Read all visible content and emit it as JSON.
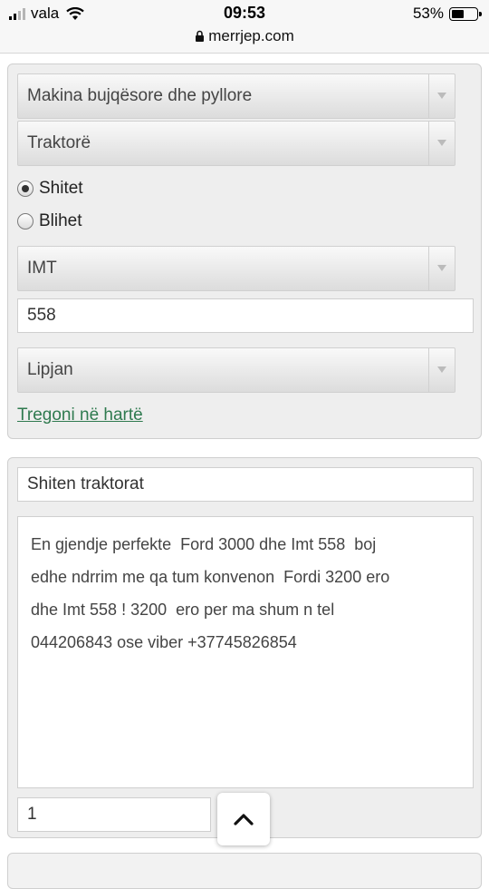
{
  "status_bar": {
    "carrier": "vala",
    "time": "09:53",
    "battery": "53%",
    "battery_level": 0.53
  },
  "browser": {
    "url": "merrjep.com"
  },
  "listing_form": {
    "category_select": "Makina bujqësore dhe pyllore",
    "subcategory_select": "Traktorë",
    "ad_type_options": [
      {
        "label": "Shitet",
        "checked": true
      },
      {
        "label": "Blihet",
        "checked": false
      }
    ],
    "make_select": "IMT",
    "model_input": "558",
    "location_select": "Lipjan",
    "map_link": "Tregoni në hartë"
  },
  "details_form": {
    "title_input": "Shiten traktorat",
    "description": "En gjendje perfekte  Ford 3000 dhe Imt 558  boj\nedhe ndrrim me qa tum konvenon  Fordi 3200 ero\ndhe Imt 558 ! 3200  ero per ma shum n tel\n044206843 ose viber +37745826854",
    "quantity_input": "1"
  },
  "icons": {
    "scroll_top": "chevron-up-icon",
    "lock": "lock-icon",
    "wifi": "wifi-icon"
  }
}
